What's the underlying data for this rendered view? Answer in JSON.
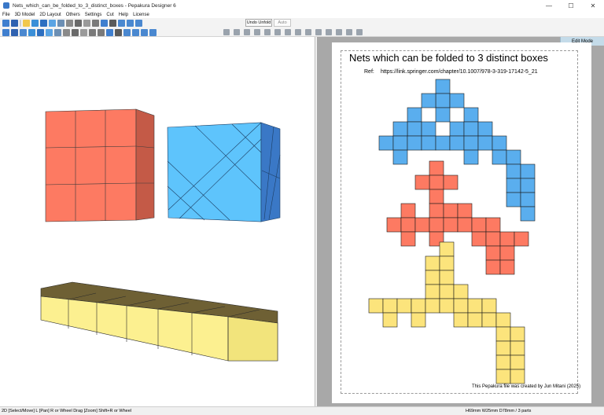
{
  "window": {
    "title": "Nets_which_can_be_folded_to_3_distinct_boxes - Pepakura Designer 6",
    "minimize": "—",
    "maximize": "☐",
    "close": "✕"
  },
  "menu": [
    "File",
    "3D Model",
    "2D Layout",
    "Others",
    "Settings",
    "Cut",
    "Help",
    "License"
  ],
  "toolbar": {
    "undo_unfold": "Undo Unfold",
    "auto": "Auto",
    "edit_mode": "Edit Mode"
  },
  "sheet": {
    "title": "Nets which can be folded to 3 distinct boxes",
    "ref_label": "Ref:",
    "ref_url": "https://link.springer.com/chapter/10.1007/978-3-319-17142-5_21",
    "credit": "This Pepakura file was created by Jun Mitani (2025)"
  },
  "status": {
    "left": "2D [Select/Move] L [Pan] R or Wheel Drag [Zoom] Shift+R or Wheel",
    "right": "H69mm W25mm D78mm / 3 parts"
  },
  "colors": {
    "red": "#fd7a62",
    "blue": "#5aaeee",
    "yellow": "#fce47c"
  }
}
